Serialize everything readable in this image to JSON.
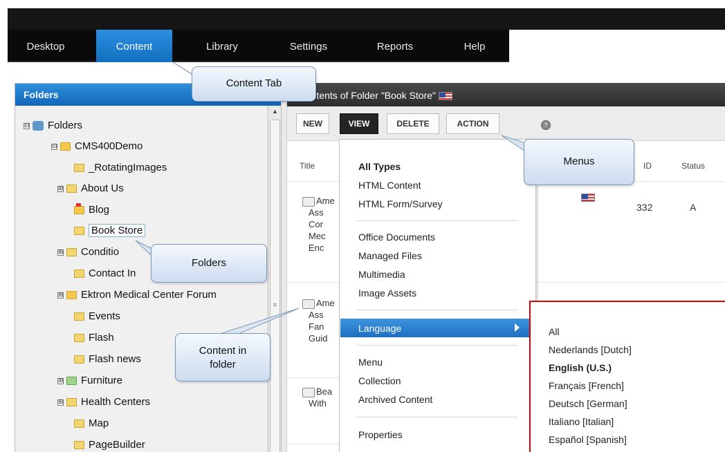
{
  "nav": {
    "tabs": [
      {
        "label": "Desktop"
      },
      {
        "label": "Content",
        "active": true
      },
      {
        "label": "Library"
      },
      {
        "label": "Settings"
      },
      {
        "label": "Reports"
      },
      {
        "label": "Help"
      }
    ]
  },
  "left_panel": {
    "header": "Folders",
    "tree": [
      {
        "label": "Folders",
        "icon": "home-folder-icon",
        "expander": "⊟"
      },
      {
        "label": "CMS400Demo",
        "icon": "open-folder-icon",
        "expander": "⊟"
      },
      {
        "label": "_RotatingImages",
        "icon": "folder-icon"
      },
      {
        "label": "About Us",
        "icon": "folder-icon",
        "expander": "⊞"
      },
      {
        "label": "Blog",
        "icon": "blog-folder-icon"
      },
      {
        "label": "Book Store",
        "icon": "folder-icon",
        "selected": true
      },
      {
        "label": "Conditio",
        "icon": "folder-icon",
        "expander": "⊞"
      },
      {
        "label": "Contact In",
        "icon": "folder-icon"
      },
      {
        "label": "Ektron Medical Center Forum",
        "icon": "forum-folder-icon",
        "expander": "⊞"
      },
      {
        "label": "Events",
        "icon": "folder-icon"
      },
      {
        "label": "Flash",
        "icon": "folder-icon"
      },
      {
        "label": "Flash news",
        "icon": "folder-icon"
      },
      {
        "label": "Furniture",
        "icon": "green-folder-icon",
        "expander": "⊞"
      },
      {
        "label": "Health Centers",
        "icon": "folder-icon",
        "expander": "⊞"
      },
      {
        "label": "Map",
        "icon": "folder-icon"
      },
      {
        "label": "PageBuilder",
        "icon": "folder-icon"
      }
    ]
  },
  "right_panel": {
    "header": "/ Contents of Folder \"Book Store\"",
    "toolbar": {
      "new": "NEW",
      "view": "VIEW",
      "delete": "DELETE",
      "action": "ACTION"
    },
    "columns": {
      "title": "Title",
      "id": "ID",
      "status": "Status"
    },
    "rows": [
      {
        "lines": [
          "Ame",
          "Ass",
          "Cor",
          "Mec",
          "Enc"
        ],
        "id": "332",
        "status": "A"
      },
      {
        "lines": [
          "Ame",
          "Ass",
          "Fan",
          "Guid"
        ],
        "id": "",
        "status": ""
      },
      {
        "lines": [
          "Bea",
          "With"
        ],
        "id": "",
        "status": ""
      }
    ]
  },
  "view_menu": {
    "group1": [
      "All Types",
      "HTML Content",
      "HTML Form/Survey"
    ],
    "group2": [
      "Office Documents",
      "Managed Files",
      "Multimedia",
      "Image Assets"
    ],
    "language": "Language",
    "group3": [
      "Menu",
      "Collection",
      "Archived Content"
    ],
    "group4": [
      "Properties"
    ]
  },
  "language_menu": {
    "items": [
      "All",
      "Nederlands [Dutch]",
      "English (U.S.)",
      "Français [French]",
      "Deutsch [German]",
      "Italiano [Italian]",
      "Español [Spanish]"
    ]
  },
  "callouts": {
    "content_tab": "Content Tab",
    "menus": "Menus",
    "folders": "Folders",
    "content_in_folder_line1": "Content in",
    "content_in_folder_line2": "folder"
  }
}
